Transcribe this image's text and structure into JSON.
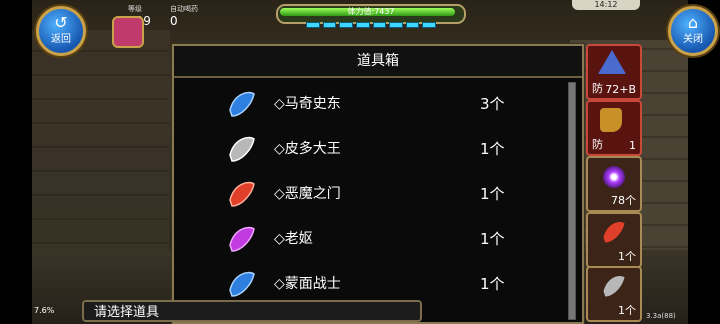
{
  "hud": {
    "back_label": "返回",
    "close_label": "关闭",
    "level_caption": "等级",
    "level_value": "229",
    "potion_caption": "自动喝药",
    "potion_value": "0",
    "hp_text": "体力值:7437",
    "hp_fraction": 0.97,
    "clock": "14:12",
    "exp_percent": "7.6%",
    "version": "3.3a(88)"
  },
  "panel": {
    "title": "道具箱",
    "items": [
      {
        "name": "◇马奇史东",
        "count": "3个",
        "gem_color": "#2f7fe0"
      },
      {
        "name": "◇皮多大王",
        "count": "1个",
        "gem_color": "#b8b8b8"
      },
      {
        "name": "◇恶魔之门",
        "count": "1个",
        "gem_color": "#e0402a"
      },
      {
        "name": "◇老妪",
        "count": "1个",
        "gem_color": "#c23be0"
      },
      {
        "name": "◇蒙面战士",
        "count": "1个",
        "gem_color": "#2f7fe0"
      }
    ]
  },
  "side_slots": [
    {
      "label": "防",
      "count": "72+B",
      "icon": "wizard-hat-icon"
    },
    {
      "label": "防",
      "count": "1",
      "icon": "boot-icon"
    },
    {
      "label": "",
      "count": "78个",
      "icon": "purple-orb-icon"
    },
    {
      "label": "",
      "count": "1个",
      "icon": "red-gem-icon"
    },
    {
      "label": "",
      "count": "1个",
      "icon": "silver-gem-icon"
    }
  ],
  "footer": {
    "prompt": "请选择道具"
  }
}
